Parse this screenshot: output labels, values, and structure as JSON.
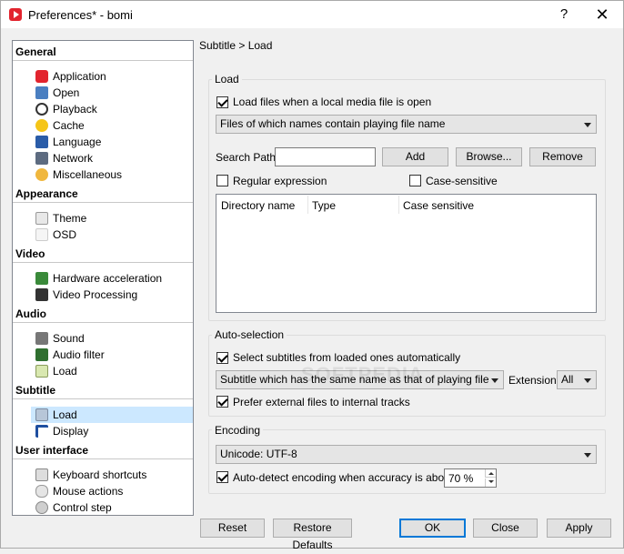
{
  "window": {
    "title": "Preferences* - bomi",
    "help_glyph": "?",
    "close_glyph": "✕"
  },
  "colors": {
    "accent": "#0078d7",
    "selection": "#cce8ff",
    "app_icon": "#e2242e"
  },
  "sidebar": {
    "categories": [
      {
        "label": "General",
        "items": [
          {
            "label": "Application",
            "icon": "app-icon"
          },
          {
            "label": "Open",
            "icon": "open-folder-icon"
          },
          {
            "label": "Playback",
            "icon": "playback-icon"
          },
          {
            "label": "Cache",
            "icon": "cache-icon"
          },
          {
            "label": "Language",
            "icon": "language-icon"
          },
          {
            "label": "Network",
            "icon": "network-icon"
          },
          {
            "label": "Miscellaneous",
            "icon": "misc-icon"
          }
        ]
      },
      {
        "label": "Appearance",
        "items": [
          {
            "label": "Theme",
            "icon": "theme-icon"
          },
          {
            "label": "OSD",
            "icon": "osd-icon"
          }
        ]
      },
      {
        "label": "Video",
        "items": [
          {
            "label": "Hardware acceleration",
            "icon": "hardware-icon"
          },
          {
            "label": "Video Processing",
            "icon": "video-processing-icon"
          }
        ]
      },
      {
        "label": "Audio",
        "items": [
          {
            "label": "Sound",
            "icon": "sound-icon"
          },
          {
            "label": "Audio filter",
            "icon": "audio-filter-icon"
          },
          {
            "label": "Load",
            "icon": "audio-load-icon"
          }
        ]
      },
      {
        "label": "Subtitle",
        "items": [
          {
            "label": "Load",
            "icon": "subtitle-load-icon",
            "selected": true
          },
          {
            "label": "Display",
            "icon": "subtitle-display-icon"
          }
        ]
      },
      {
        "label": "User interface",
        "items": [
          {
            "label": "Keyboard shortcuts",
            "icon": "keyboard-icon"
          },
          {
            "label": "Mouse actions",
            "icon": "mouse-icon"
          },
          {
            "label": "Control step",
            "icon": "control-step-icon"
          }
        ]
      }
    ]
  },
  "breadcrumb": "Subtitle > Load",
  "load_group": {
    "title": "Load",
    "load_files_label": "Load files when a local media file is open",
    "load_files_checked": true,
    "mode_combo": "Files of which names contain playing file name",
    "search_path_label": "Search Path",
    "search_path_value": "",
    "add_label": "Add",
    "browse_label": "Browse...",
    "remove_label": "Remove",
    "regex_label": "Regular expression",
    "regex_checked": false,
    "case_label": "Case-sensitive",
    "case_checked": false,
    "columns": [
      "Directory name",
      "Type",
      "Case sensitive"
    ]
  },
  "autoselect_group": {
    "title": "Auto-selection",
    "select_label": "Select subtitles from loaded ones automatically",
    "select_checked": true,
    "mode_combo": "Subtitle which has the same name as that of playing file",
    "extension_label": "Extension",
    "extension_value": "All",
    "prefer_label": "Prefer external files to internal tracks",
    "prefer_checked": true
  },
  "encoding_group": {
    "title": "Encoding",
    "encoding_combo": "Unicode: UTF-8",
    "autodetect_label": "Auto-detect encoding when accuracy is above",
    "autodetect_checked": true,
    "accuracy_value": "70 %"
  },
  "footer": {
    "reset_label": "Reset",
    "restore_label": "Restore Defaults",
    "ok_label": "OK",
    "close_label": "Close",
    "apply_label": "Apply"
  },
  "watermark": "SOFTPEDIA"
}
